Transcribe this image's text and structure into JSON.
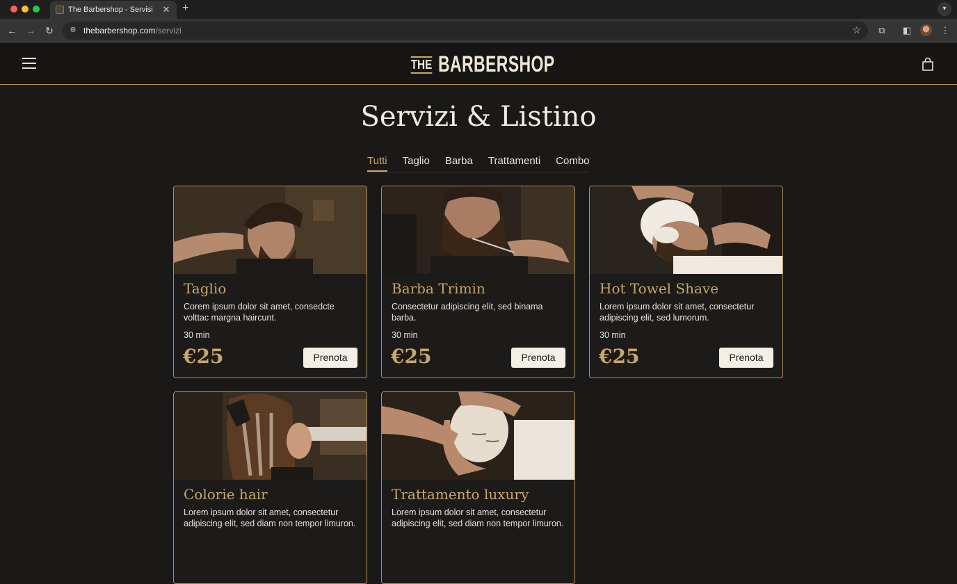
{
  "browser": {
    "tab_title": "The Barbershop - Servisi",
    "tab_close": "✕",
    "new_tab": "+",
    "url_host": "thebarbershop.com",
    "url_path": "/servizi"
  },
  "site": {
    "logo_the": "THE",
    "logo_main": "BARBERSHOP"
  },
  "page": {
    "title": "Servizi & Listino",
    "tabs": [
      "Tutti",
      "Taglio",
      "Barba",
      "Trattamenti",
      "Combo"
    ],
    "active_tab": "Tutti"
  },
  "services": [
    {
      "title": "Taglio",
      "description": "Corem ipsum dolor sit amet, consedcte volttac margna haircunt.",
      "duration": "30 min",
      "price": "€25",
      "button": "Prenota"
    },
    {
      "title": "Barba Trimin",
      "description": "Consectetur adipiscing elit, sed binama barba.",
      "duration": "30 min",
      "price": "€25",
      "button": "Prenota"
    },
    {
      "title": "Hot Towel Shave",
      "description": "Lorem ipsum dolor sit amet, consectetur adipiscing elit, sed lumorum.",
      "duration": "30 min",
      "price": "€25",
      "button": "Prenota"
    },
    {
      "title": "Colorie hair",
      "description": "Lorem ipsum dolor sit amet, consectetur adipiscing elit, sed diam non tempor limuron."
    },
    {
      "title": "Trattamento luxury",
      "description": "Lorem ipsum dolor sit amet, consectetur adipiscing elit, sed diam non tempor limuron."
    }
  ],
  "colors": {
    "accent_gold": "#c8a866",
    "background": "#1a1918",
    "card_border": "#b09252"
  }
}
